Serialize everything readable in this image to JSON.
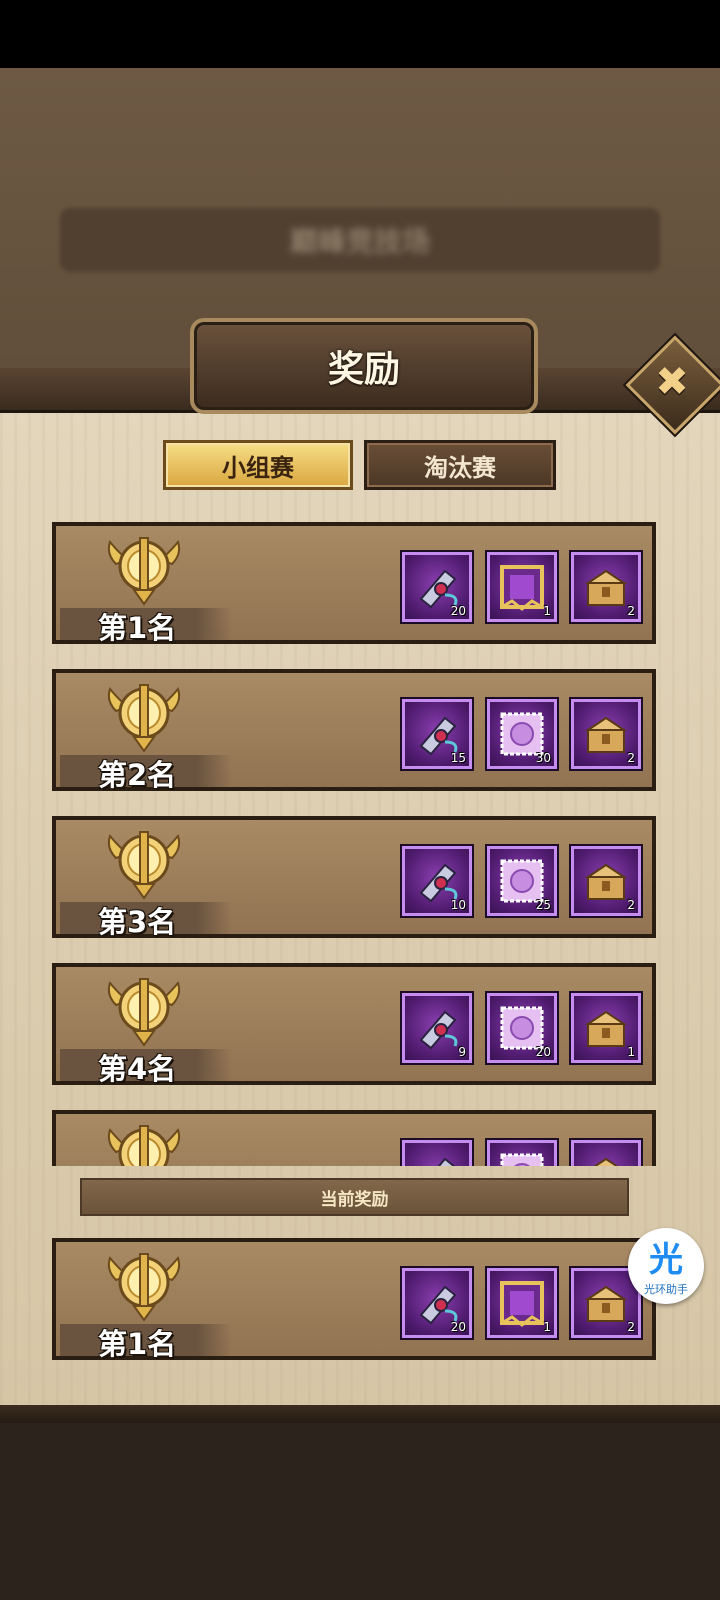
{
  "background": {
    "banner_text": "巅峰竞技场"
  },
  "dialog": {
    "title": "奖励",
    "close_glyph": "✖"
  },
  "tabs": [
    {
      "label": "小组赛",
      "active": true
    },
    {
      "label": "淘汰赛",
      "active": false
    }
  ],
  "ranks": [
    {
      "label": "第1名",
      "rewards": [
        {
          "icon": "scroll-icon",
          "count": "20"
        },
        {
          "icon": "frame-icon",
          "count": "1"
        },
        {
          "icon": "chest-icon",
          "count": "2"
        }
      ]
    },
    {
      "label": "第2名",
      "rewards": [
        {
          "icon": "scroll-icon",
          "count": "15"
        },
        {
          "icon": "stamp-icon",
          "count": "30"
        },
        {
          "icon": "chest-icon",
          "count": "2"
        }
      ]
    },
    {
      "label": "第3名",
      "rewards": [
        {
          "icon": "scroll-icon",
          "count": "10"
        },
        {
          "icon": "stamp-icon",
          "count": "25"
        },
        {
          "icon": "chest-icon",
          "count": "2"
        }
      ]
    },
    {
      "label": "第4名",
      "rewards": [
        {
          "icon": "scroll-icon",
          "count": "9"
        },
        {
          "icon": "stamp-icon",
          "count": "20"
        },
        {
          "icon": "chest-icon",
          "count": "1"
        }
      ]
    },
    {
      "label": "",
      "rewards": [
        {
          "icon": "scroll-icon",
          "count": ""
        },
        {
          "icon": "stamp-icon",
          "count": ""
        },
        {
          "icon": "chest-icon",
          "count": ""
        }
      ]
    }
  ],
  "current": {
    "banner_label": "当前奖励",
    "rank_label": "第1名",
    "rewards": [
      {
        "icon": "scroll-icon",
        "count": "20"
      },
      {
        "icon": "frame-icon",
        "count": "1"
      },
      {
        "icon": "chest-icon",
        "count": "2"
      }
    ]
  },
  "floating_assistant": {
    "glyph": "光",
    "label": "光环助手"
  },
  "colors": {
    "accent_gold": "#f7de86",
    "item_purple": "#8a3fb0",
    "panel_parchment": "#e3d6bc"
  }
}
